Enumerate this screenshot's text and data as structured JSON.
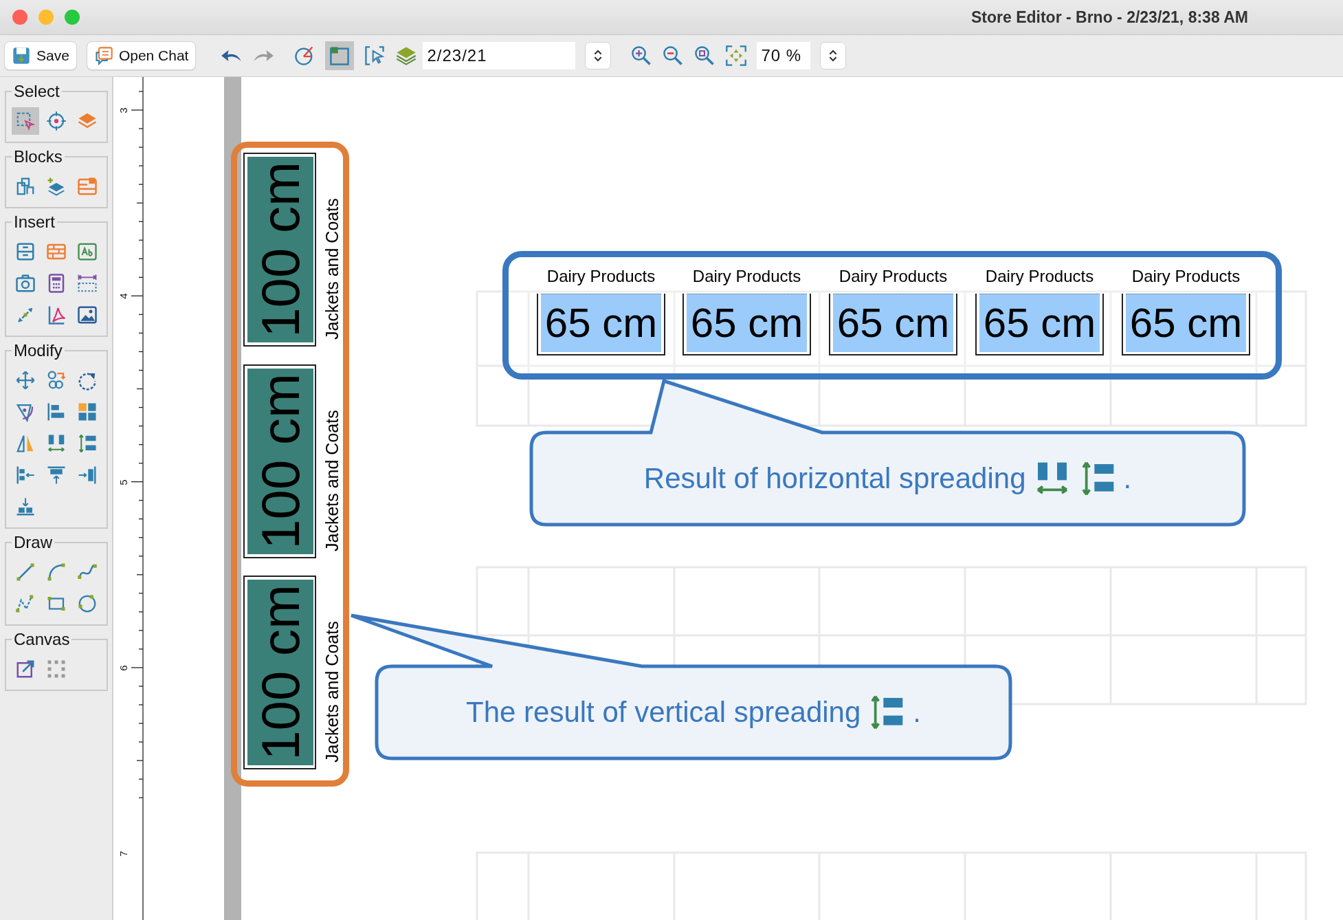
{
  "window": {
    "title": "Store Editor - Brno - 2/23/21, 8:38 AM"
  },
  "toolbar": {
    "save": "Save",
    "open_chat": "Open Chat",
    "redo_disabled": true,
    "frame_toggle_selected": true,
    "date": "2/23/21",
    "zoom": "70 %"
  },
  "palette": [
    {
      "title": "Select",
      "tools": [
        {
          "selected": true
        },
        {
          "selected": false
        },
        {
          "selected": false
        }
      ]
    },
    {
      "title": "Blocks",
      "tools": [
        {
          "selected": false
        },
        {
          "selected": false
        },
        {
          "selected": false
        }
      ]
    },
    {
      "title": "Insert",
      "tools": [
        {
          "selected": false
        },
        {
          "selected": false
        },
        {
          "selected": false
        },
        {
          "selected": false
        },
        {
          "selected": false
        },
        {
          "selected": false
        },
        {
          "selected": false
        },
        {
          "selected": false
        },
        {
          "selected": false
        }
      ]
    },
    {
      "title": "Modify",
      "tools": [
        {
          "selected": false
        },
        {
          "selected": false
        },
        {
          "selected": false
        },
        {
          "selected": false
        },
        {
          "selected": false
        },
        {
          "selected": false
        },
        {
          "selected": false
        },
        {
          "selected": false
        },
        {
          "selected": false
        },
        {
          "selected": false
        },
        {
          "selected": false
        },
        {
          "selected": false
        },
        {
          "selected": false
        }
      ]
    },
    {
      "title": "Draw",
      "tools": [
        {
          "selected": false
        },
        {
          "selected": false
        },
        {
          "selected": false
        },
        {
          "selected": false
        },
        {
          "selected": false
        },
        {
          "selected": false
        }
      ]
    },
    {
      "title": "Canvas",
      "tools": [
        {
          "selected": false
        },
        {
          "selected": false
        }
      ]
    }
  ],
  "ruler": {
    "labels": [
      "3",
      "4",
      "5",
      "6",
      "7"
    ]
  },
  "vertical_shelves": [
    {
      "label": "Jackets and Coats",
      "size": "100 cm"
    },
    {
      "label": "Jackets and Coats",
      "size": "100 cm"
    },
    {
      "label": "Jackets and Coats",
      "size": "100 cm"
    }
  ],
  "horizontal_shelves": [
    {
      "label": "Dairy Products",
      "size": "65 cm"
    },
    {
      "label": "Dairy Products",
      "size": "65 cm"
    },
    {
      "label": "Dairy Products",
      "size": "65 cm"
    },
    {
      "label": "Dairy Products",
      "size": "65 cm"
    },
    {
      "label": "Dairy Products",
      "size": "65 cm"
    }
  ],
  "callouts": [
    {
      "kind": "horizontal",
      "text": "Result of horizontal spreading",
      "end": "."
    },
    {
      "kind": "vertical",
      "text": "The result of vertical spreading",
      "end": "."
    }
  ]
}
